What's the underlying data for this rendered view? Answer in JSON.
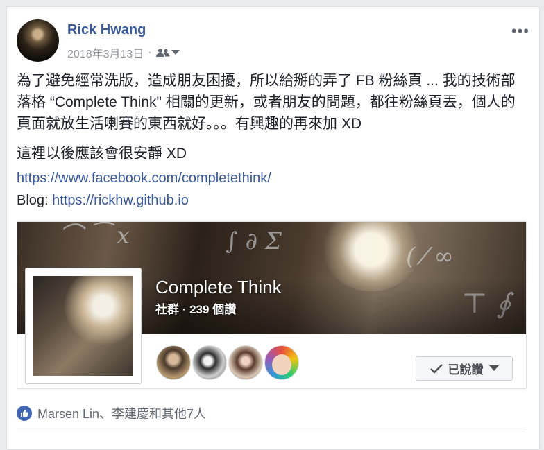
{
  "post": {
    "author": "Rick Hwang",
    "date": "2018年3月13日",
    "meta_separator": "·",
    "audience_icon": "friends-icon",
    "more_label": "•••",
    "text": "為了避免經常洗版，造成朋友困擾，所以給掰的弄了 FB 粉絲頁 ... 我的技術部落格 “Complete Think\" 相關的更新，或者朋友的問題，都往粉絲頁丟，個人的頁面就放生活喇賽的東西就好。。。有興趣的再來加 XD",
    "text2": "這裡以後應該會很安靜 XD",
    "link": "https://www.facebook.com/completethink/",
    "blog_prefix": "Blog: ",
    "blog_link": "https://rickhw.github.io"
  },
  "shared_page": {
    "name": "Complete Think",
    "subtitle": "社群 · 239 個讚",
    "liked_button": "已說讚"
  },
  "reactions": {
    "text": "Marsen Lin、李建慶和其他7人"
  },
  "colors": {
    "link": "#385898",
    "like_blue": "#4267b2",
    "meta_gray": "#90949c"
  }
}
